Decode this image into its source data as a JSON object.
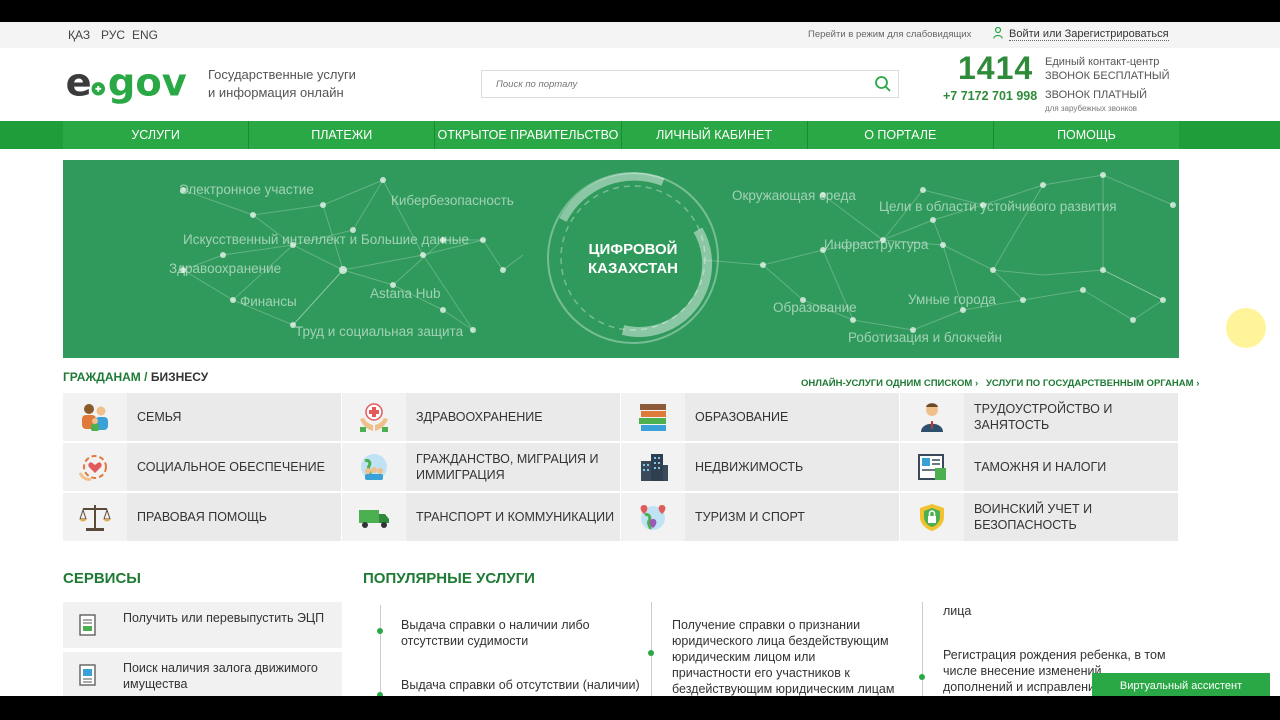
{
  "langs": [
    "ҚАЗ",
    "РУС",
    "ENG"
  ],
  "topbar": {
    "vision_mode": "Перейти в режим для слабовидящих",
    "login": "Войти или Зарегистрироваться"
  },
  "header": {
    "tagline_1": "Государственные услуги",
    "tagline_2": "и информация онлайн",
    "search_placeholder": "Поиск по порталу",
    "phone_short": "1414",
    "phone_full": "+7 7172 701 998",
    "contact_center": "Единый контакт-центр",
    "free_call": "ЗВОНОК БЕСПЛАТНЫЙ",
    "paid_call": "ЗВОНОК ПЛАТНЫЙ",
    "foreign_calls": "для зарубежных звонков"
  },
  "nav": [
    "УСЛУГИ",
    "ПЛАТЕЖИ",
    "ОТКРЫТОЕ ПРАВИТЕЛЬСТВО",
    "ЛИЧНЫЙ КАБИНЕТ",
    "О ПОРТАЛЕ",
    "ПОМОЩЬ"
  ],
  "banner": {
    "center_1": "ЦИФРОВОЙ",
    "center_2": "КАЗАХСТАН",
    "labels": [
      "Электронное участие",
      "Кибербезопасность",
      "Искусственный интеллект и Большие данные",
      "Здравоохранение",
      "Финансы",
      "Astana Hub",
      "Труд и социальная защита",
      "Окружающая среда",
      "Цели в области устойчивого развития",
      "Инфраструктура",
      "Образование",
      "Умные города",
      "Роботизация и блокчейн"
    ]
  },
  "section": {
    "citizens": "ГРАЖДАНАМ",
    "sep": " / ",
    "business": "БИЗНЕСУ",
    "link_list": "ОНЛАЙН-УСЛУГИ ОДНИМ СПИСКОМ",
    "link_agencies": "УСЛУГИ ПО ГОСУДАРСТВЕННЫМ ОРГАНАМ"
  },
  "categories": [
    {
      "label": "СЕМЬЯ",
      "icon": "family-icon"
    },
    {
      "label": "ЗДРАВООХРАНЕНИЕ",
      "icon": "health-icon"
    },
    {
      "label": "ОБРАЗОВАНИЕ",
      "icon": "books-icon"
    },
    {
      "label": "ТРУДОУСТРОЙСТВО И ЗАНЯТОСТЬ",
      "icon": "worker-icon"
    },
    {
      "label": "СОЦИАЛЬНОЕ ОБЕСПЕЧЕНИЕ",
      "icon": "social-icon"
    },
    {
      "label": "ГРАЖДАНСТВО, МИГРАЦИЯ И ИММИГРАЦИЯ",
      "icon": "migration-icon"
    },
    {
      "label": "НЕДВИЖИМОСТЬ",
      "icon": "buildings-icon"
    },
    {
      "label": "ТАМОЖНЯ И НАЛОГИ",
      "icon": "customs-icon"
    },
    {
      "label": "ПРАВОВАЯ ПОМОЩЬ",
      "icon": "scales-icon"
    },
    {
      "label": "ТРАНСПОРТ И КОММУНИКАЦИИ",
      "icon": "truck-icon"
    },
    {
      "label": "ТУРИЗМ И СПОРТ",
      "icon": "map-pin-icon"
    },
    {
      "label": "ВОИНСКИЙ УЧЕТ И БЕЗОПАСНОСТЬ",
      "icon": "shield-icon"
    }
  ],
  "services": {
    "title": "СЕРВИСЫ",
    "items": [
      {
        "label": "Получить или перевыпустить ЭЦП",
        "icon": "certificate-icon"
      },
      {
        "label": "Поиск наличия залога движимого имущества",
        "icon": "document-search-icon"
      }
    ]
  },
  "popular": {
    "title": "ПОПУЛЯРНЫЕ УСЛУГИ",
    "col1": [
      "Выдача справки о наличии либо отсутствии судимости",
      "Выдача справки об отсутствии (наличии)"
    ],
    "col2": [
      "Получение справки о признании юридического лица бездействующим юридическим лицом или причастности его участников к бездействующим юридическим лицам"
    ],
    "col3": [
      "лица",
      "Регистрация рождения ребенка, в том числе внесение изменений, дополнений и исправлений в записи ак"
    ]
  },
  "assistant": "Виртуальный ассистент",
  "colors": {
    "brand_green": "#2aa845",
    "dark_green": "#1e7a34",
    "banner_green": "#2f9a5b"
  }
}
